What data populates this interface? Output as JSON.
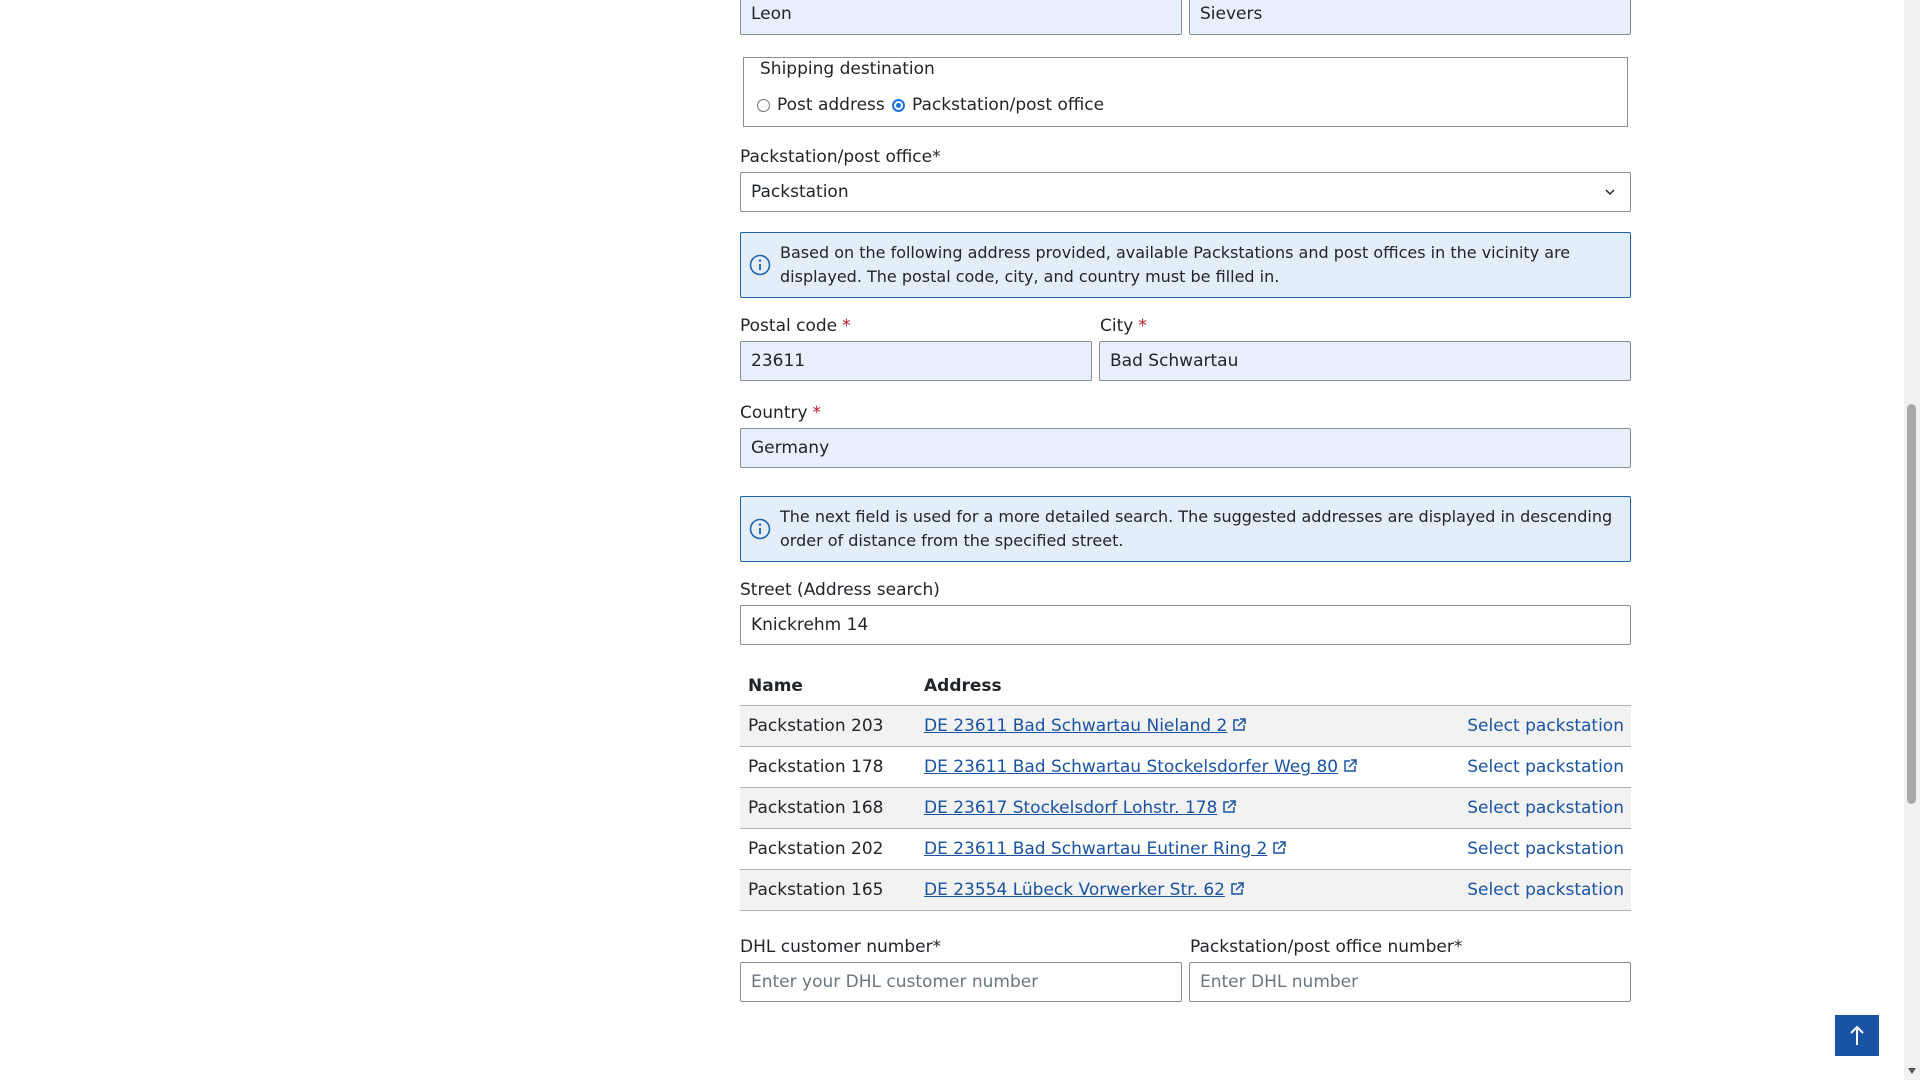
{
  "name": {
    "first_value": "Leon",
    "last_value": "Sievers"
  },
  "shipping_destination": {
    "legend": "Shipping destination",
    "options": [
      {
        "label": "Post address",
        "checked": false
      },
      {
        "label": "Packstation/post office",
        "checked": true
      }
    ]
  },
  "packstation_type": {
    "label": "Packstation/post office*",
    "value": "Packstation"
  },
  "info_address": "Based on the following address provided, available Packstations and post offices in the vicinity are displayed. The postal code, city, and country must be filled in.",
  "postal_code": {
    "label": "Postal code",
    "required_mark": "*",
    "value": "23611"
  },
  "city": {
    "label": "City",
    "required_mark": "*",
    "value": "Bad Schwartau"
  },
  "country": {
    "label": "Country",
    "required_mark": "*",
    "value": "Germany"
  },
  "info_search": "The next field is used for a more detailed search. The suggested addresses are displayed in descending order of distance from the specified street.",
  "street": {
    "label": "Street (Address search)",
    "value": "Knickrehm 14"
  },
  "table": {
    "headers": {
      "name": "Name",
      "address": "Address"
    },
    "select_label": "Select packstation",
    "rows": [
      {
        "name": "Packstation 203",
        "address": "DE 23611 Bad Schwartau Nieland 2"
      },
      {
        "name": "Packstation 178",
        "address": "DE 23611 Bad Schwartau Stockelsdorfer Weg 80"
      },
      {
        "name": "Packstation 168",
        "address": "DE 23617 Stockelsdorf Lohstr. 178"
      },
      {
        "name": "Packstation 202",
        "address": "DE 23611 Bad Schwartau Eutiner Ring 2"
      },
      {
        "name": "Packstation 165",
        "address": "DE 23554 Lübeck Vorwerker Str. 62"
      }
    ]
  },
  "dhl_customer": {
    "label": "DHL customer number*",
    "placeholder": "Enter your DHL customer number"
  },
  "post_number": {
    "label": "Packstation/post office number*",
    "placeholder": "Enter DHL number"
  },
  "colors": {
    "accent": "#1853a4",
    "info_border": "#1e63a6",
    "info_bg": "#e3eefa",
    "required": "#c0112b",
    "autofill_bg": "#e8f0fe"
  },
  "icons": {
    "info": "info-circle-icon",
    "external": "external-link-icon",
    "chevron": "chevron-down-icon",
    "back_to_top": "arrow-up-icon"
  }
}
